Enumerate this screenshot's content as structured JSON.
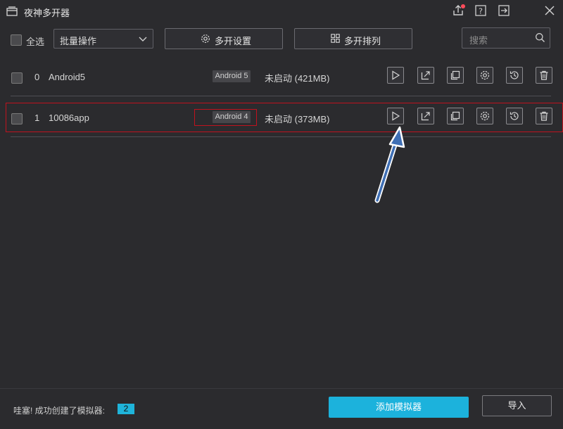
{
  "window": {
    "title": "夜神多开器",
    "icons": [
      "app-icon",
      "upload-icon",
      "help-icon",
      "exit-icon",
      "close-icon"
    ]
  },
  "toolbar": {
    "select_all_label": "全选",
    "batch_label": "批量操作",
    "settings_label": "多开设置",
    "arrange_label": "多开排列",
    "search_placeholder": "搜索"
  },
  "instances": [
    {
      "index": "0",
      "name": "Android5",
      "version": "Android 5",
      "status": "未启动 (421MB)"
    },
    {
      "index": "1",
      "name": "10086app",
      "version": "Android 4",
      "status": "未启动 (373MB)"
    }
  ],
  "row_actions": [
    "play-icon",
    "share-icon",
    "clone-icon",
    "gear-icon",
    "history-icon",
    "trash-icon"
  ],
  "footer": {
    "message": "哇塞! 成功创建了模拟器:",
    "count": "2",
    "add_label": "添加模拟器",
    "import_label": "导入"
  },
  "colors": {
    "background": "#2b2b2e",
    "accent": "#1cb2dc",
    "highlight": "#c0121e",
    "arrow": "#3f6fb5"
  }
}
